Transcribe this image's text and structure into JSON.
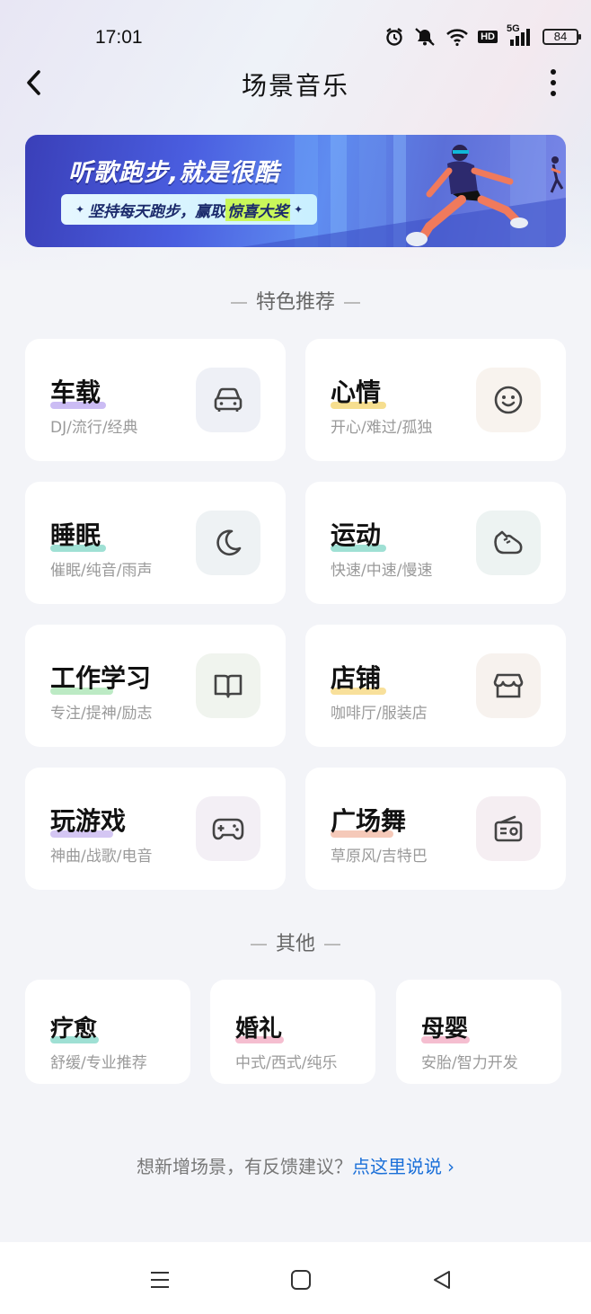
{
  "status": {
    "time": "17:01",
    "network": "5G",
    "battery": "84",
    "hd": "HD",
    "icons": [
      "alarm-icon",
      "mute-icon",
      "wifi-icon",
      "hd-icon",
      "signal-icon",
      "battery-icon"
    ]
  },
  "nav": {
    "title": "场景音乐",
    "back_icon": "back-icon",
    "more_icon": "more-icon"
  },
  "banner": {
    "title": "听歌跑步,就是很酷",
    "subtitle_prefix": "坚持每天跑步，赢取",
    "subtitle_highlight": "惊喜大奖"
  },
  "featured": {
    "section_label": "特色推荐",
    "items": [
      {
        "title": "车载",
        "sub": "DJ/流行/经典",
        "icon": "car-icon",
        "accent": "#b9a6f0",
        "icon_bg": "#eef0f6"
      },
      {
        "title": "心情",
        "sub": "开心/难过/孤独",
        "icon": "smile-icon",
        "accent": "#f3d36a",
        "icon_bg": "#f8f3ee"
      },
      {
        "title": "睡眠",
        "sub": "催眠/纯音/雨声",
        "icon": "moon-icon",
        "accent": "#7fd6c6",
        "icon_bg": "#eef2f4"
      },
      {
        "title": "运动",
        "sub": "快速/中速/慢速",
        "icon": "sneaker-icon",
        "accent": "#7fd6c6",
        "icon_bg": "#edf3f2"
      },
      {
        "title": "工作学习",
        "sub": "专注/提神/励志",
        "icon": "book-icon",
        "accent": "#a6e3b0",
        "icon_bg": "#f0f4ee"
      },
      {
        "title": "店铺",
        "sub": "咖啡厅/服装店",
        "icon": "store-icon",
        "accent": "#f6d67a",
        "icon_bg": "#f7f2ee"
      },
      {
        "title": "玩游戏",
        "sub": "神曲/战歌/电音",
        "icon": "gamepad-icon",
        "accent": "#c5b3ef",
        "icon_bg": "#f3eff5"
      },
      {
        "title": "广场舞",
        "sub": "草原风/吉特巴",
        "icon": "radio-icon",
        "accent": "#f2b7a2",
        "icon_bg": "#f5eef2"
      }
    ]
  },
  "others": {
    "section_label": "其他",
    "items": [
      {
        "title": "疗愈",
        "sub": "舒缓/专业推荐",
        "accent": "#7fd6c6"
      },
      {
        "title": "婚礼",
        "sub": "中式/西式/纯乐",
        "accent": "#f2a8c0"
      },
      {
        "title": "母婴",
        "sub": "安胎/智力开发",
        "accent": "#f2a8c0"
      }
    ]
  },
  "feedback": {
    "text": "想新增场景，有反馈建议？",
    "link": "点这里说说",
    "chevron": "›"
  },
  "system_nav": {
    "icons": [
      "menu-icon",
      "home-icon",
      "back-triangle-icon"
    ]
  }
}
